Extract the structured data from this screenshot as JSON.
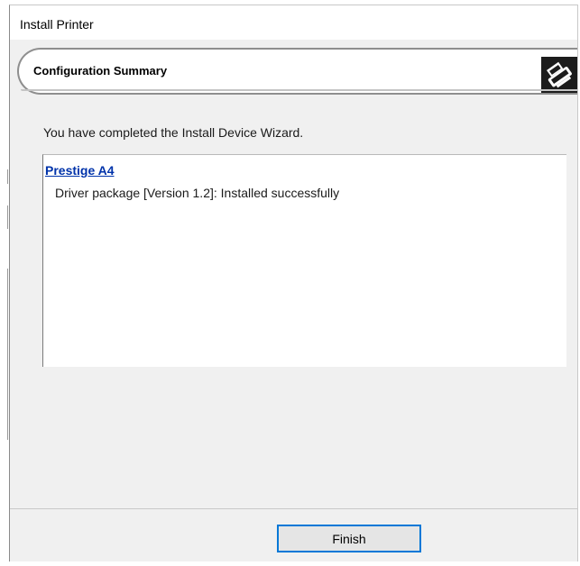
{
  "window": {
    "title": "Install Printer"
  },
  "banner": {
    "title": "Configuration Summary",
    "icon": "printer-icon"
  },
  "intro": {
    "text": "You have completed the Install Device Wizard."
  },
  "result": {
    "device_name": "Prestige A4",
    "status_text": "Driver package [Version 1.2]: Installed successfully"
  },
  "footer": {
    "finish_label": "Finish"
  },
  "colors": {
    "link": "#0033aa",
    "button_focus_border": "#0078d7",
    "dialog_background": "#f0f0f0"
  }
}
